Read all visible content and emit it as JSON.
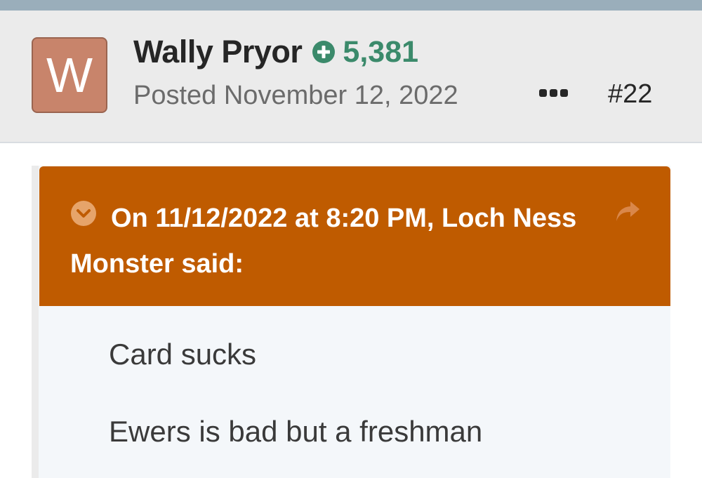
{
  "post": {
    "author": {
      "avatar_letter": "W",
      "avatar_color": "#c8846b",
      "name": "Wally Pryor",
      "reputation": "5,381",
      "reputation_icon": "plus-circle-icon",
      "reputation_color": "#3b8a6b"
    },
    "posted": "Posted November 12, 2022",
    "more_icon": "ellipsis-icon",
    "number": "#22"
  },
  "quote": {
    "accent_color": "#bf5b00",
    "toggle_icon": "chevron-down-circle-icon",
    "share_icon": "share-arrow-icon",
    "citation": "On 11/12/2022 at 8:20 PM, Loch Ness Monster said:",
    "lines": [
      "Card sucks",
      "Ewers is bad but a freshman"
    ]
  }
}
